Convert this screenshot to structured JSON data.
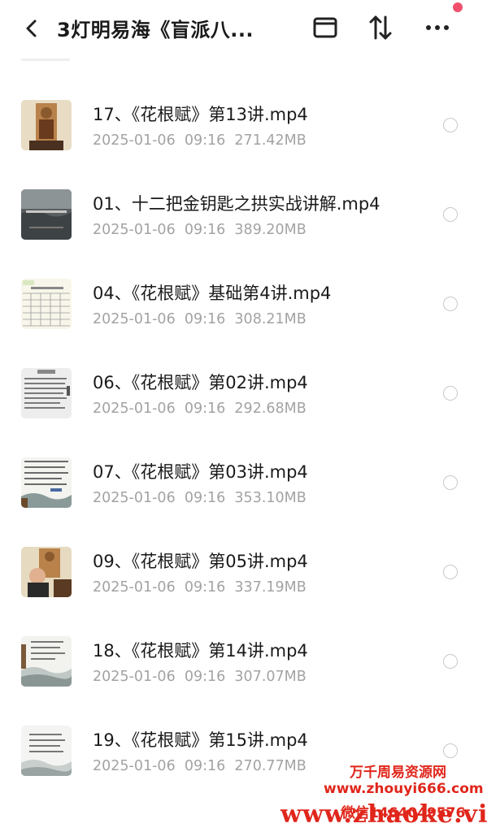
{
  "header": {
    "title": "3灯明易海《盲派八...",
    "back_icon": "chevron-left-icon",
    "icons": [
      "window-icon",
      "sort-icon",
      "more-icon"
    ],
    "notify_color": "#f0506e"
  },
  "files": [
    {
      "name": "17、《花根赋》第13讲.mp4",
      "date": "2025-01-06",
      "time": "09:16",
      "size": "271.42MB",
      "thumb": "statue"
    },
    {
      "name": "01、十二把金钥匙之拱实战讲解.mp4",
      "date": "2025-01-06",
      "time": "09:16",
      "size": "389.20MB",
      "thumb": "landscape"
    },
    {
      "name": "04、《花根赋》基础第4讲.mp4",
      "date": "2025-01-06",
      "time": "09:16",
      "size": "308.21MB",
      "thumb": "table"
    },
    {
      "name": "06、《花根赋》第02讲.mp4",
      "date": "2025-01-06",
      "time": "09:16",
      "size": "292.68MB",
      "thumb": "text"
    },
    {
      "name": "07、《花根赋》第03讲.mp4",
      "date": "2025-01-06",
      "time": "09:16",
      "size": "353.10MB",
      "thumb": "text-wave"
    },
    {
      "name": "09、《花根赋》第05讲.mp4",
      "date": "2025-01-06",
      "time": "09:16",
      "size": "337.19MB",
      "thumb": "statue-person"
    },
    {
      "name": "18、《花根赋》第14讲.mp4",
      "date": "2025-01-06",
      "time": "09:16",
      "size": "307.07MB",
      "thumb": "text-wave"
    },
    {
      "name": "19、《花根赋》第15讲.mp4",
      "date": "2025-01-06",
      "time": "09:16",
      "size": "270.77MB",
      "thumb": "text-wave"
    }
  ],
  "watermark": {
    "line1": "万千周易资源网",
    "line2": "www.zhouyi666.com",
    "line3": "微信1464049576",
    "line4": "www.zhaoke.vip",
    "color": "#e0261b"
  }
}
